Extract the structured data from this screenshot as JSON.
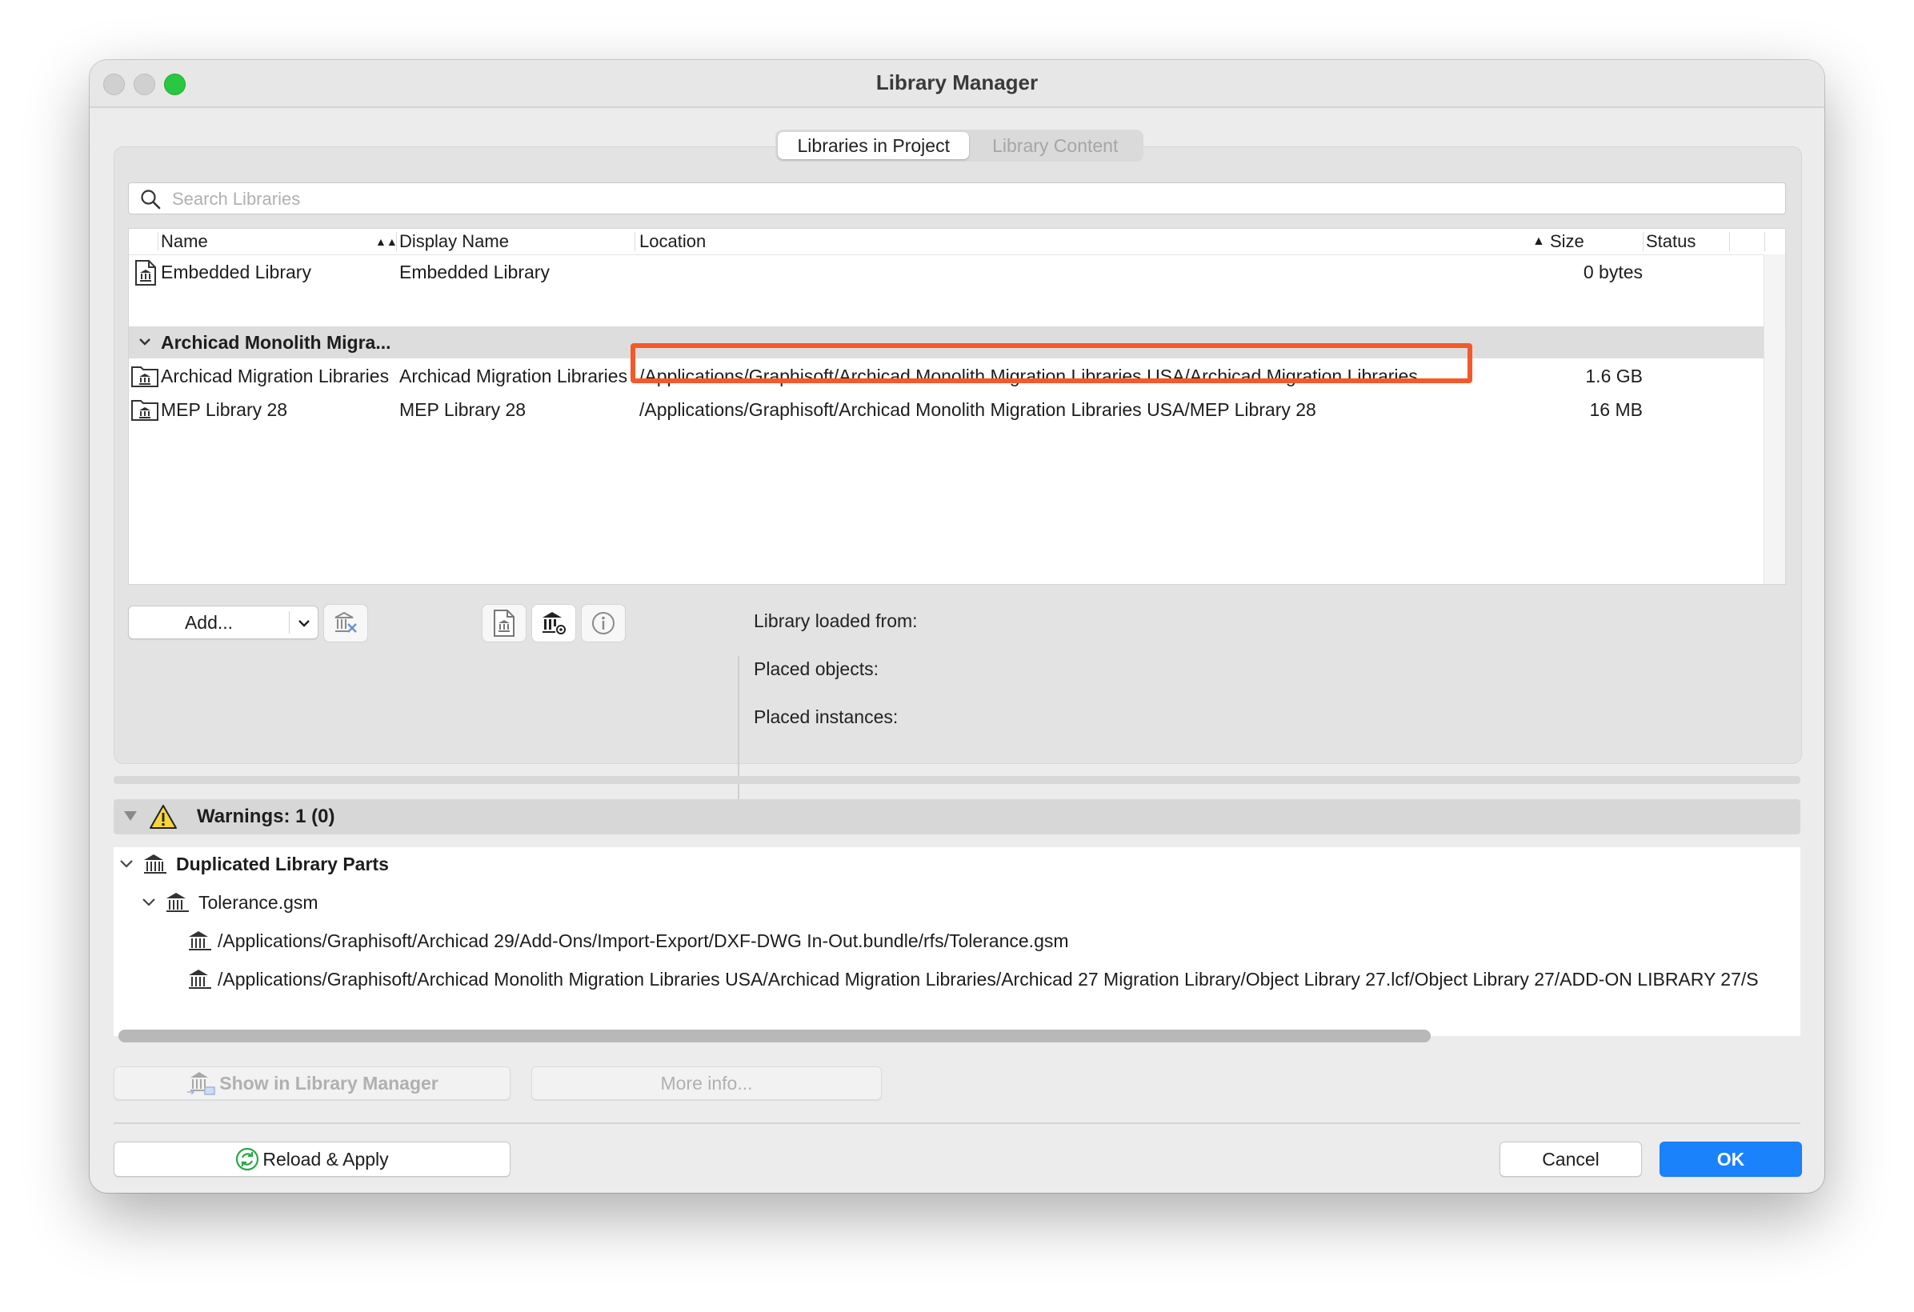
{
  "window": {
    "title": "Library Manager"
  },
  "tabs": [
    {
      "label": "Libraries in Project",
      "active": true
    },
    {
      "label": "Library Content",
      "active": false
    }
  ],
  "search": {
    "placeholder": "Search Libraries",
    "value": ""
  },
  "table": {
    "columns": {
      "name": "Name",
      "display_name": "Display Name",
      "location": "Location",
      "size": "Size",
      "status": "Status"
    },
    "sort": {
      "name": "▲▲",
      "size": "▲"
    },
    "embedded": {
      "name": "Embedded Library",
      "display_name": "Embedded Library",
      "location": "",
      "size": "0 bytes",
      "status": ""
    },
    "group": {
      "label": "Archicad Monolith Migra..."
    },
    "rows": [
      {
        "name": "Archicad Migration Libraries",
        "display_name": "Archicad Migration Libraries",
        "location": "/Applications/Graphisoft/Archicad Monolith Migration Libraries USA/Archicad Migration Libraries",
        "size": "1.6 GB",
        "status": ""
      },
      {
        "name": "MEP Library 28",
        "display_name": "MEP Library 28",
        "location": "/Applications/Graphisoft/Archicad Monolith Migration Libraries USA/MEP Library 28",
        "size": "16 MB",
        "status": ""
      }
    ]
  },
  "actions": {
    "add_label": "Add..."
  },
  "info": {
    "loaded_from_label": "Library loaded from:",
    "placed_objects_label": "Placed objects:",
    "placed_instances_label": "Placed instances:"
  },
  "warnings": {
    "title": "Warnings: 1 (0)",
    "category": "Duplicated Library Parts",
    "file": "Tolerance.gsm",
    "paths": [
      "/Applications/Graphisoft/Archicad 29/Add-Ons/Import-Export/DXF-DWG In-Out.bundle/rfs/Tolerance.gsm",
      "/Applications/Graphisoft/Archicad Monolith Migration Libraries USA/Archicad Migration Libraries/Archicad 27 Migration Library/Object Library 27.lcf/Object Library 27/ADD-ON LIBRARY 27/S"
    ]
  },
  "buttons": {
    "show_in_library_manager": "Show in Library Manager",
    "more_info": "More info...",
    "reload_apply": "Reload & Apply",
    "cancel": "Cancel",
    "ok": "OK"
  },
  "colors": {
    "accent": "#1a82fb",
    "highlight": "#f5582a",
    "reload_icon": "#2aa84a"
  }
}
